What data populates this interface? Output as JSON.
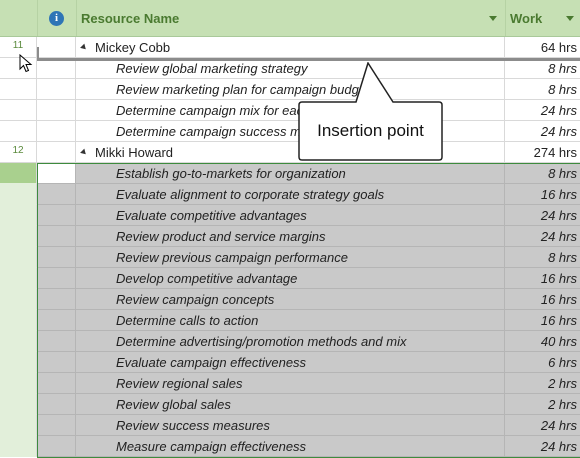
{
  "header": {
    "info_icon": "i",
    "name_label": "Resource Name",
    "work_label": "Work"
  },
  "rows": [
    {
      "id": "11",
      "name": "Mickey Cobb",
      "work": "64 hrs",
      "type": "summary"
    },
    {
      "id": "",
      "name": "Review global marketing strategy",
      "work": "8 hrs",
      "type": "task"
    },
    {
      "id": "",
      "name": "Review marketing plan for campaign budget",
      "work": "8 hrs",
      "type": "task"
    },
    {
      "id": "",
      "name": "Determine campaign mix for each region",
      "work": "24 hrs",
      "type": "task"
    },
    {
      "id": "",
      "name": "Determine campaign success measurements",
      "work": "24 hrs",
      "type": "task"
    },
    {
      "id": "12",
      "name": "Mikki Howard",
      "work": "274 hrs",
      "type": "summary"
    },
    {
      "id": "",
      "name": "Establish go-to-markets for organization",
      "work": "8 hrs",
      "type": "selected"
    },
    {
      "id": "",
      "name": "Evaluate alignment to corporate strategy goals",
      "work": "16 hrs",
      "type": "selected"
    },
    {
      "id": "",
      "name": "Evaluate competitive advantages",
      "work": "24 hrs",
      "type": "selected"
    },
    {
      "id": "",
      "name": "Review product and service margins",
      "work": "24 hrs",
      "type": "selected"
    },
    {
      "id": "",
      "name": "Review previous campaign performance",
      "work": "8 hrs",
      "type": "selected"
    },
    {
      "id": "",
      "name": "Develop competitive advantage",
      "work": "16 hrs",
      "type": "selected"
    },
    {
      "id": "",
      "name": "Review campaign concepts",
      "work": "16 hrs",
      "type": "selected"
    },
    {
      "id": "",
      "name": "Determine calls to action",
      "work": "16 hrs",
      "type": "selected"
    },
    {
      "id": "",
      "name": "Determine advertising/promotion methods and mix",
      "work": "40 hrs",
      "type": "selected"
    },
    {
      "id": "",
      "name": "Evaluate campaign effectiveness",
      "work": "6 hrs",
      "type": "selected"
    },
    {
      "id": "",
      "name": "Review regional sales",
      "work": "2 hrs",
      "type": "selected"
    },
    {
      "id": "",
      "name": "Review global sales",
      "work": "2 hrs",
      "type": "selected"
    },
    {
      "id": "",
      "name": "Review success measures",
      "work": "24 hrs",
      "type": "selected"
    },
    {
      "id": "",
      "name": "Measure campaign effectiveness",
      "work": "24 hrs",
      "type": "selected"
    }
  ],
  "callout": {
    "text": "Insertion point"
  },
  "colors": {
    "header_bg": "#c6e0b4",
    "header_text": "#4a7a30",
    "selection": "#c9c9c9",
    "info_icon": "#2e75b6"
  }
}
